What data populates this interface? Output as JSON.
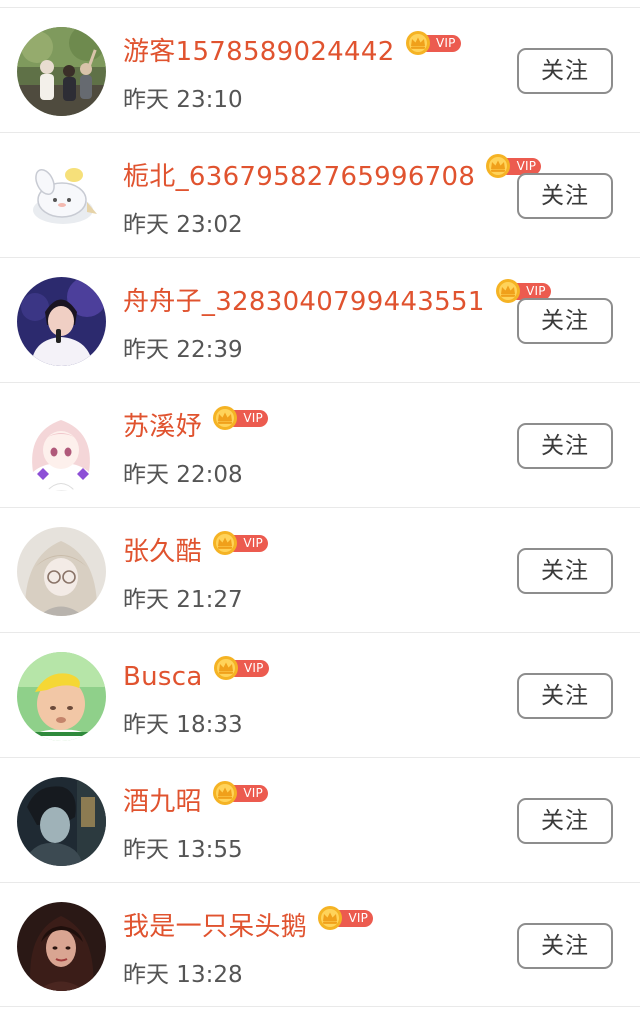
{
  "follower_list": {
    "follow_label": "关注",
    "vip_label": "VIP",
    "items": [
      {
        "name": "游客1578589024442",
        "time": "昨天 23:10",
        "avatar_icon": "avatar-group-hiking-photo",
        "vip": true
      },
      {
        "name": "栀北_63679582765996708",
        "time": "昨天 23:02",
        "avatar_icon": "avatar-cartoon-bunny",
        "vip": true
      },
      {
        "name": "舟舟子_3283040799443551",
        "time": "昨天 22:39",
        "avatar_icon": "avatar-singer-stage-photo",
        "vip": true
      },
      {
        "name": "苏溪妤",
        "time": "昨天 22:08",
        "avatar_icon": "avatar-anime-girl-pink",
        "vip": true
      },
      {
        "name": "张久酷",
        "time": "昨天 21:27",
        "avatar_icon": "avatar-anime-girl-glasses",
        "vip": true
      },
      {
        "name": "Busca",
        "time": "昨天 18:33",
        "avatar_icon": "avatar-child-photo",
        "vip": true
      },
      {
        "name": "酒九昭",
        "time": "昨天 13:55",
        "avatar_icon": "avatar-dark-portrait-photo",
        "vip": true
      },
      {
        "name": "我是一只呆头鹅",
        "time": "昨天 13:28",
        "avatar_icon": "avatar-woman-portrait-photo",
        "vip": true
      }
    ]
  },
  "colors": {
    "username": "#e0532f",
    "vip_pill": "#ec5b4f",
    "crown": "#f5b324",
    "time_text": "#555555",
    "button_border": "#8d8d8d",
    "divider": "#e9e9e9"
  }
}
